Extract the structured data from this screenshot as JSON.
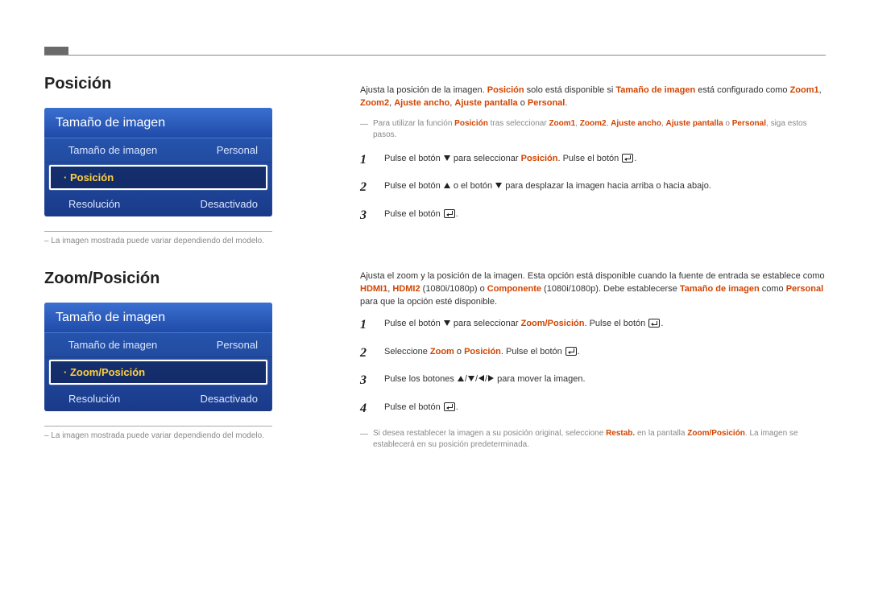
{
  "section1": {
    "title": "Posición",
    "menu": {
      "title": "Tamaño de imagen",
      "rows": [
        {
          "label": "Tamaño de imagen",
          "value": "Personal",
          "selected": false
        },
        {
          "label": "Posición",
          "value": "",
          "selected": true
        },
        {
          "label": "Resolución",
          "value": "Desactivado",
          "selected": false
        }
      ]
    },
    "caption": "La imagen mostrada puede variar dependiendo del modelo.",
    "intro_pre": "Ajusta la posición de la imagen. ",
    "intro_hl1": "Posición",
    "intro_mid1": " solo está disponible si ",
    "intro_hl2": "Tamaño de imagen",
    "intro_mid2": " está configurado como ",
    "intro_hl3": "Zoom1",
    "intro_sep1": ", ",
    "intro_hl4": "Zoom2",
    "intro_sep2": ", ",
    "intro_hl5": "Ajuste ancho",
    "intro_sep3": ", ",
    "intro_hl6": "Ajuste pantalla",
    "intro_sep4": " o ",
    "intro_hl7": "Personal",
    "intro_end": ".",
    "note_pre": "Para utilizar la función ",
    "note_hl1": "Posición",
    "note_mid1": " tras seleccionar ",
    "note_hl2": "Zoom1",
    "note_s1": ", ",
    "note_hl3": "Zoom2",
    "note_s2": ", ",
    "note_hl4": "Ajuste ancho",
    "note_s3": ", ",
    "note_hl5": "Ajuste pantalla",
    "note_s4": " o ",
    "note_hl6": "Personal",
    "note_end": ", siga estos pasos.",
    "step1_pre": "Pulse el botón ",
    "step1_mid": " para seleccionar ",
    "step1_hl": "Posición",
    "step1_after": ". Pulse el botón ",
    "step1_end": ".",
    "step2_pre": "Pulse el botón ",
    "step2_mid": " o el botón ",
    "step2_end": " para desplazar la imagen hacia arriba o hacia abajo.",
    "step3_pre": "Pulse el botón ",
    "step3_end": "."
  },
  "section2": {
    "title": "Zoom/Posición",
    "menu": {
      "title": "Tamaño de imagen",
      "rows": [
        {
          "label": "Tamaño de imagen",
          "value": "Personal",
          "selected": false
        },
        {
          "label": "Zoom/Posición",
          "value": "",
          "selected": true
        },
        {
          "label": "Resolución",
          "value": "Desactivado",
          "selected": false
        }
      ]
    },
    "caption": "La imagen mostrada puede variar dependiendo del modelo.",
    "intro_pre": "Ajusta el zoom y la posición de la imagen. Esta opción está disponible cuando la fuente de entrada se establece como ",
    "intro_hl1": "HDMI1",
    "intro_s1": ", ",
    "intro_hl2": "HDMI2",
    "intro_paren1": " (1080i/1080p) o ",
    "intro_hl3": "Componente",
    "intro_paren2": " (1080i/1080p). Debe establecerse ",
    "intro_hl4": "Tamaño de imagen",
    "intro_mid": " como ",
    "intro_hl5": "Personal",
    "intro_end": " para que la opción esté disponible.",
    "step1_pre": "Pulse el botón ",
    "step1_mid": " para seleccionar ",
    "step1_hl": "Zoom/Posición",
    "step1_after": ". Pulse el botón ",
    "step1_end": ".",
    "step2_pre": "Seleccione ",
    "step2_hl1": "Zoom",
    "step2_or": " o ",
    "step2_hl2": "Posición",
    "step2_after": ". Pulse el botón ",
    "step2_end": ".",
    "step3_pre": "Pulse los botones ",
    "step3_end": " para mover la imagen.",
    "step4_pre": "Pulse el botón ",
    "step4_end": ".",
    "tail_pre": "Si desea restablecer la imagen a su posición original, seleccione ",
    "tail_hl1": "Restab.",
    "tail_mid": " en la pantalla ",
    "tail_hl2": "Zoom/Posición",
    "tail_end": ". La imagen se establecerá en su posición predeterminada."
  }
}
